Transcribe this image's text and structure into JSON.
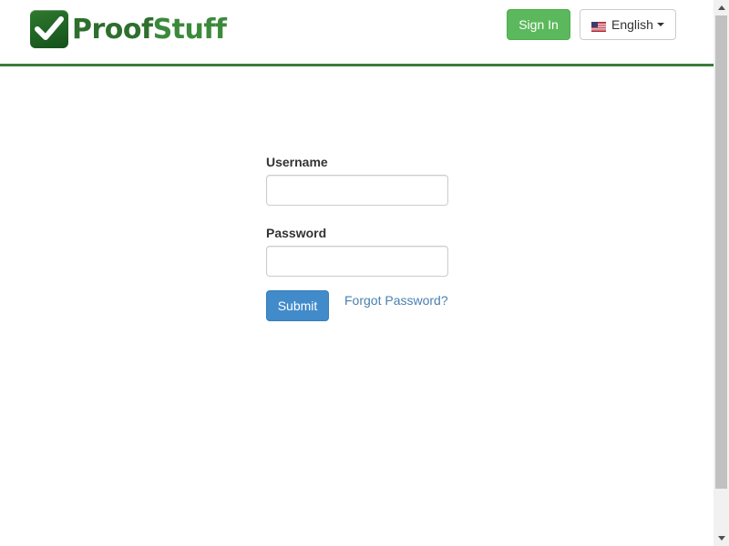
{
  "header": {
    "logo": {
      "text_part1": "Proof",
      "text_part2": "Stuff",
      "icon": "checkmark-icon"
    },
    "signin_label": "Sign In",
    "language": {
      "selected": "English",
      "flag": "us-flag-icon"
    }
  },
  "form": {
    "username_label": "Username",
    "username_value": "",
    "password_label": "Password",
    "password_value": "",
    "submit_label": "Submit",
    "forgot_label": "Forgot Password?"
  },
  "colors": {
    "brand_green": "#2e6f2e",
    "header_border": "#3b7b3b",
    "signin_green": "#5cb85c",
    "submit_blue": "#428bca",
    "link_blue": "#4a7fb0"
  }
}
